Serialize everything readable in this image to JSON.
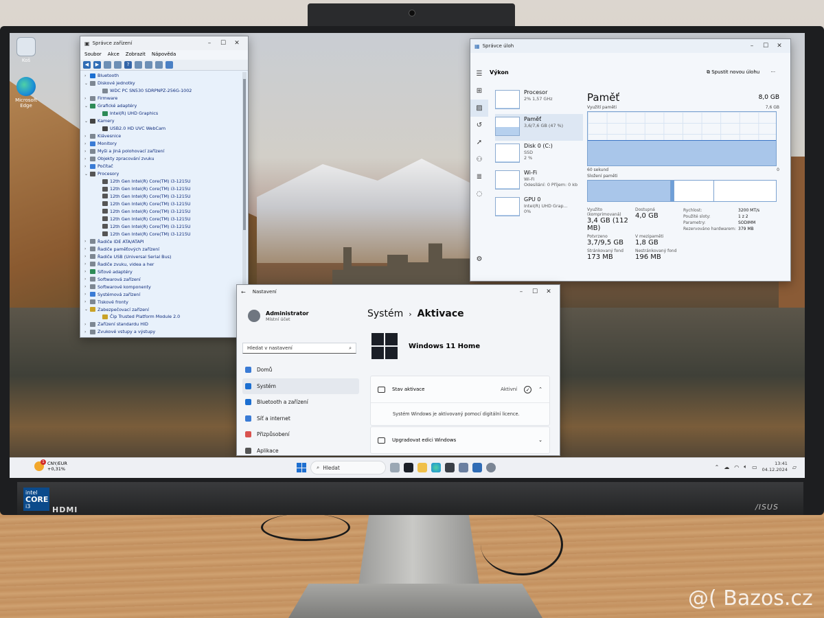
{
  "device_manager": {
    "title": "Správce zařízení",
    "menu": [
      "Soubor",
      "Akce",
      "Zobrazit",
      "Nápověda"
    ],
    "tree": [
      {
        "label": "Bluetooth",
        "level": 0,
        "state": "collapsed",
        "color": "#1c6fd1"
      },
      {
        "label": "Diskové jednotky",
        "level": 0,
        "state": "expanded",
        "color": "#7d8792"
      },
      {
        "label": "WDC PC SN530 SDRPNPZ-256G-1002",
        "level": 1,
        "state": "leaf",
        "color": "#7d8792"
      },
      {
        "label": "Firmware",
        "level": 0,
        "state": "collapsed",
        "color": "#7d8792"
      },
      {
        "label": "Grafické adaptéry",
        "level": 0,
        "state": "expanded",
        "color": "#2e8b57"
      },
      {
        "label": "Intel(R) UHD Graphics",
        "level": 1,
        "state": "leaf",
        "color": "#2e8b57"
      },
      {
        "label": "Kamery",
        "level": 0,
        "state": "expanded",
        "color": "#444444"
      },
      {
        "label": "USB2.0 HD UVC WebCam",
        "level": 1,
        "state": "leaf",
        "color": "#444444"
      },
      {
        "label": "Klávesnice",
        "level": 0,
        "state": "collapsed",
        "color": "#7d8792"
      },
      {
        "label": "Monitory",
        "level": 0,
        "state": "collapsed",
        "color": "#3a7bd5"
      },
      {
        "label": "Myši a jiná polohovací zařízení",
        "level": 0,
        "state": "collapsed",
        "color": "#7d8792"
      },
      {
        "label": "Objekty zpracování zvuku",
        "level": 0,
        "state": "collapsed",
        "color": "#7d8792"
      },
      {
        "label": "Počítač",
        "level": 0,
        "state": "collapsed",
        "color": "#3a7bd5"
      },
      {
        "label": "Procesory",
        "level": 0,
        "state": "expanded",
        "color": "#555555"
      },
      {
        "label": "12th Gen Intel(R) Core(TM) i3-1215U",
        "level": 1,
        "state": "leaf",
        "color": "#555555"
      },
      {
        "label": "12th Gen Intel(R) Core(TM) i3-1215U",
        "level": 1,
        "state": "leaf",
        "color": "#555555"
      },
      {
        "label": "12th Gen Intel(R) Core(TM) i3-1215U",
        "level": 1,
        "state": "leaf",
        "color": "#555555"
      },
      {
        "label": "12th Gen Intel(R) Core(TM) i3-1215U",
        "level": 1,
        "state": "leaf",
        "color": "#555555"
      },
      {
        "label": "12th Gen Intel(R) Core(TM) i3-1215U",
        "level": 1,
        "state": "leaf",
        "color": "#555555"
      },
      {
        "label": "12th Gen Intel(R) Core(TM) i3-1215U",
        "level": 1,
        "state": "leaf",
        "color": "#555555"
      },
      {
        "label": "12th Gen Intel(R) Core(TM) i3-1215U",
        "level": 1,
        "state": "leaf",
        "color": "#555555"
      },
      {
        "label": "12th Gen Intel(R) Core(TM) i3-1215U",
        "level": 1,
        "state": "leaf",
        "color": "#555555"
      },
      {
        "label": "Řadiče IDE ATA/ATAPI",
        "level": 0,
        "state": "collapsed",
        "color": "#7d8792"
      },
      {
        "label": "Řadiče paměťových zařízení",
        "level": 0,
        "state": "collapsed",
        "color": "#7d8792"
      },
      {
        "label": "Řadiče USB (Universal Serial Bus)",
        "level": 0,
        "state": "collapsed",
        "color": "#7d8792"
      },
      {
        "label": "Řadiče zvuku, videa a her",
        "level": 0,
        "state": "collapsed",
        "color": "#7d8792"
      },
      {
        "label": "Síťové adaptéry",
        "level": 0,
        "state": "collapsed",
        "color": "#2e8b57"
      },
      {
        "label": "Softwarová zařízení",
        "level": 0,
        "state": "collapsed",
        "color": "#7d8792"
      },
      {
        "label": "Softwarové komponenty",
        "level": 0,
        "state": "collapsed",
        "color": "#7d8792"
      },
      {
        "label": "Systémová zařízení",
        "level": 0,
        "state": "collapsed",
        "color": "#3a7bd5"
      },
      {
        "label": "Tiskové fronty",
        "level": 0,
        "state": "collapsed",
        "color": "#7d8792"
      },
      {
        "label": "Zabezpečovací zařízení",
        "level": 0,
        "state": "expanded",
        "color": "#c9a227"
      },
      {
        "label": "Čip Trusted Platform Module 2.0",
        "level": 1,
        "state": "leaf",
        "color": "#c9a227"
      },
      {
        "label": "Zařízení standardu HID",
        "level": 0,
        "state": "collapsed",
        "color": "#7d8792"
      },
      {
        "label": "Zvukové vstupy a výstupy",
        "level": 0,
        "state": "collapsed",
        "color": "#7d8792"
      }
    ]
  },
  "task_manager": {
    "title": "Správce úloh",
    "section": "Výkon",
    "new_task": "Spustit novou úlohu",
    "list": [
      {
        "name": "Procesor",
        "sub": "2% 1,57 GHz",
        "sub2": "",
        "level": 0.02
      },
      {
        "name": "Paměť",
        "sub": "3,6/7,6 GB (47 %)",
        "sub2": "",
        "level": 0.47
      },
      {
        "name": "Disk 0 (C:)",
        "sub": "SSD",
        "sub2": "2 %",
        "level": 0.02
      },
      {
        "name": "Wi-Fi",
        "sub": "Wi-Fi",
        "sub2": "Odesílání: 0 Příjem: 0 kb",
        "level": 0.05
      },
      {
        "name": "GPU 0",
        "sub": "Intel(R) UHD Grap...",
        "sub2": "0%",
        "level": 0.0
      }
    ],
    "memory": {
      "title": "Paměť",
      "total": "8,0 GB",
      "usage_label": "Využití paměti",
      "usage_max": "7,6 GB",
      "time_label": "60 sekund",
      "time_end": "0",
      "usage_level": 0.47,
      "composition_label": "Složení paměti",
      "stats": [
        {
          "label": "Využito (komprimovaná)",
          "value": "3,4 GB (112 MB)"
        },
        {
          "label": "Dostupná",
          "value": "4,0 GB"
        },
        {
          "label": "Potvrzeno",
          "value": "3,7/9,5 GB"
        },
        {
          "label": "V mezipaměti",
          "value": "1,8 GB"
        },
        {
          "label": "Stránkovaný fond",
          "value": "173 MB"
        },
        {
          "label": "Nestránkovaný fond",
          "value": "196 MB"
        }
      ],
      "details": [
        {
          "label": "Rychlost:",
          "value": "3200 MT/s"
        },
        {
          "label": "Použité sloty:",
          "value": "1 z 2"
        },
        {
          "label": "Parametry:",
          "value": "SODIMM"
        },
        {
          "label": "Rezervováno hardwarem:",
          "value": "379 MB"
        }
      ]
    }
  },
  "settings": {
    "title": "Nastavení",
    "user_name": "Administrator",
    "user_role": "Místní účet",
    "search_placeholder": "Hledat v nastavení",
    "nav": [
      {
        "label": "Domů",
        "icon": "home-icon",
        "color": "#3a7bd5"
      },
      {
        "label": "Systém",
        "icon": "monitor-icon",
        "color": "#1c6fd1"
      },
      {
        "label": "Bluetooth a zařízení",
        "icon": "bluetooth-icon",
        "color": "#1c6fd1"
      },
      {
        "label": "Síť a internet",
        "icon": "wifi-icon",
        "color": "#3a7bd5"
      },
      {
        "label": "Přizpůsobení",
        "icon": "brush-icon",
        "color": "#d9534f"
      },
      {
        "label": "Aplikace",
        "icon": "apps-icon",
        "color": "#555555"
      }
    ],
    "breadcrumb_parent": "Systém",
    "breadcrumb_sep": "›",
    "breadcrumb_current": "Aktivace",
    "edition": "Windows 11 Home",
    "activation_label": "Stav aktivace",
    "activation_status": "Aktivní",
    "activation_desc": "Systém Windows je aktivovaný pomocí digitální licence.",
    "upgrade_label": "Upgradovat edici Windows"
  },
  "taskbar": {
    "weather_top": "CNY/EUR",
    "weather_bottom": "+0,31%",
    "notif": "1",
    "search": "Hledat",
    "time": "13:41",
    "date": "04.12.2024"
  },
  "desktop": {
    "recycle_bin": "Koš",
    "edge": "Microsoft Edge"
  },
  "hardware": {
    "intel_top": "intel",
    "intel_core": "CORE",
    "intel_gen": "i3",
    "hdmi": "HDMI",
    "brand": "/ISUS"
  },
  "watermark": "@( Bazos.cz"
}
